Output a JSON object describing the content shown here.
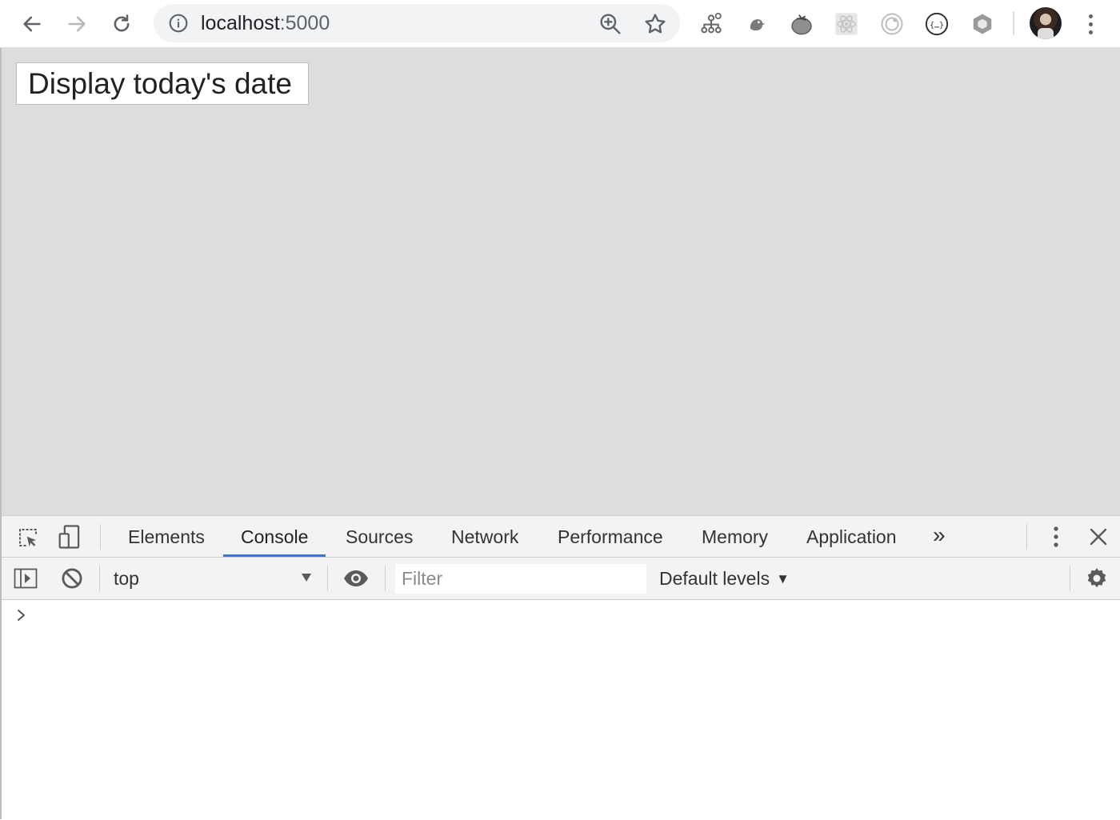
{
  "browser": {
    "url_host": "localhost",
    "url_port": ":5000",
    "icons": {
      "back": "back-arrow-icon",
      "forward": "forward-arrow-icon",
      "reload": "reload-icon",
      "info": "info-icon",
      "zoom": "zoom-in-icon",
      "bookmark": "star-icon",
      "menu": "kebab-menu-icon"
    },
    "extensions": [
      "sitemap-extension-icon",
      "bird-extension-icon",
      "tomato-extension-icon",
      "react-devtools-extension-icon",
      "circle-extension-icon",
      "json-extension-icon",
      "cube-extension-icon"
    ]
  },
  "page": {
    "button_label": "Display today's date",
    "background": "#dddddd"
  },
  "devtools": {
    "tabs": [
      {
        "label": "Elements",
        "active": false
      },
      {
        "label": "Console",
        "active": true
      },
      {
        "label": "Sources",
        "active": false
      },
      {
        "label": "Network",
        "active": false
      },
      {
        "label": "Performance",
        "active": false
      },
      {
        "label": "Memory",
        "active": false
      },
      {
        "label": "Application",
        "active": false
      }
    ],
    "more_tabs": "»",
    "context": "top",
    "filter_placeholder": "Filter",
    "levels_label": "Default levels",
    "prompt_symbol": ">",
    "accent": "#3a78d8"
  }
}
